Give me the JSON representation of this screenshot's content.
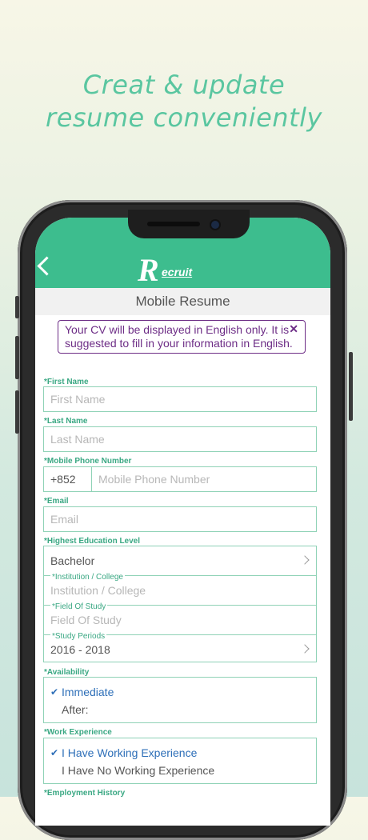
{
  "promo": {
    "line1": "Creat & update",
    "line2": "resume conveniently"
  },
  "app": {
    "logo_big": "R",
    "logo_small": "ecruit",
    "title": "Mobile Resume"
  },
  "notice": {
    "text": "Your CV will be displayed in English only. It is suggested to fill in your information in English.",
    "close": "✕"
  },
  "form": {
    "first_name": {
      "label": "*First Name",
      "placeholder": "First Name"
    },
    "last_name": {
      "label": "*Last Name",
      "placeholder": "Last Name"
    },
    "mobile": {
      "label": "*Mobile Phone Number",
      "country_code": "+852",
      "placeholder": "Mobile Phone Number"
    },
    "email": {
      "label": "*Email",
      "placeholder": "Email"
    },
    "education": {
      "label": "*Highest Education Level",
      "level_value": "Bachelor",
      "institution_label": "*Institution / College",
      "institution_placeholder": "Institution / College",
      "field_label": "*Field Of Study",
      "field_placeholder": "Field Of Study",
      "period_label": "*Study Periods",
      "period_value": "2016 - 2018"
    },
    "availability": {
      "label": "*Availability",
      "option_selected": "Immediate",
      "option_other": "After:"
    },
    "work_experience": {
      "label": "*Work Experience",
      "option_selected": "I Have Working Experience",
      "option_other": "I Have No Working Experience"
    },
    "employment_history": {
      "label": "*Employment History"
    }
  },
  "colors": {
    "brand_green": "#3dbd8e",
    "accent_purple": "#6d2d86",
    "selected_blue": "#2e6fb8"
  }
}
